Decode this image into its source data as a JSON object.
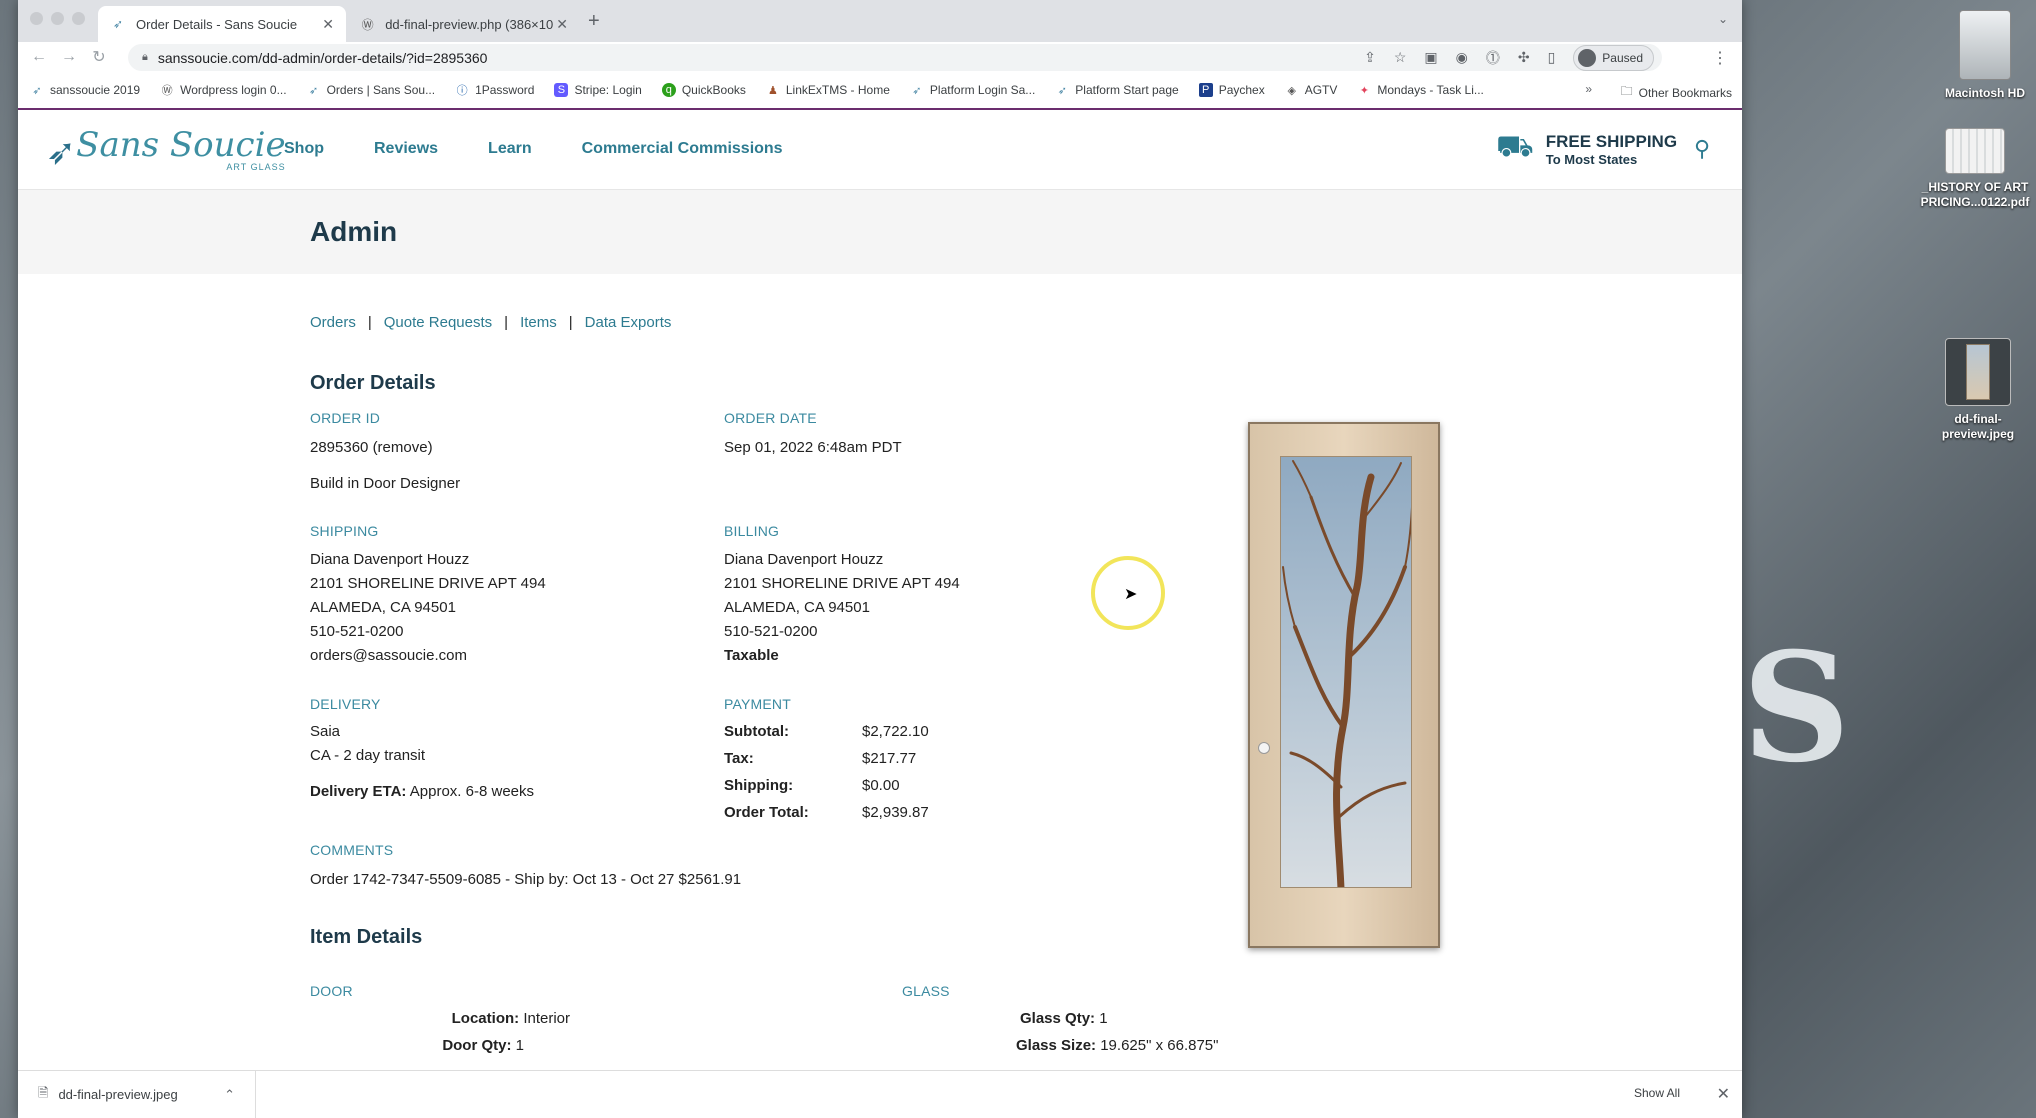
{
  "browser": {
    "tabs": [
      {
        "title": "Order Details - Sans Soucie",
        "active": true
      },
      {
        "title": "dd-final-preview.php (386×10",
        "active": false
      }
    ],
    "url": "sanssoucie.com/dd-admin/order-details/?id=2895360",
    "profile_status": "Paused",
    "bookmarks": [
      "sanssoucie 2019",
      "Wordpress login 0...",
      "Orders | Sans Sou...",
      "1Password",
      "Stripe: Login",
      "QuickBooks",
      "LinkExTMS - Home",
      "Platform Login Sa...",
      "Platform Start page",
      "Paychex",
      "AGTV",
      "Mondays - Task Li..."
    ],
    "bookmarks_more": "»",
    "other_bookmarks": "Other Bookmarks"
  },
  "site": {
    "logo_text": "Sans Soucie",
    "logo_sub": "ART GLASS",
    "nav": [
      "Shop",
      "Reviews",
      "Learn",
      "Commercial Commissions"
    ],
    "shipping_title": "FREE SHIPPING",
    "shipping_sub": "To Most States"
  },
  "admin": {
    "title": "Admin",
    "subnav": [
      "Orders",
      "Quote Requests",
      "Items",
      "Data Exports"
    ],
    "order_details_title": "Order Details",
    "order_id_label": "ORDER ID",
    "order_id_value": "2895360 (remove)",
    "build_note": "Build in Door Designer",
    "order_date_label": "ORDER DATE",
    "order_date_value": "Sep 01, 2022 6:48am PDT",
    "shipping_label": "SHIPPING",
    "shipping": [
      "Diana Davenport Houzz",
      "2101 SHORELINE DRIVE APT 494",
      "ALAMEDA, CA 94501",
      "510-521-0200",
      "orders@sassoucie.com"
    ],
    "billing_label": "BILLING",
    "billing": [
      "Diana Davenport Houzz",
      "2101 SHORELINE DRIVE APT 494",
      "ALAMEDA, CA 94501",
      "510-521-0200"
    ],
    "billing_taxable": "Taxable",
    "delivery_label": "DELIVERY",
    "delivery": [
      "Saia",
      "CA - 2 day transit"
    ],
    "delivery_eta_label": "Delivery ETA:",
    "delivery_eta_value": "Approx. 6-8 weeks",
    "payment_label": "PAYMENT",
    "payment": [
      {
        "k": "Subtotal:",
        "v": "$2,722.10"
      },
      {
        "k": "Tax:",
        "v": "$217.77"
      },
      {
        "k": "Shipping:",
        "v": "$0.00"
      },
      {
        "k": "Order Total:",
        "v": "$2,939.87"
      }
    ],
    "comments_label": "COMMENTS",
    "comments_value": "Order 1742-7347-5509-6085 - Ship by: Oct 13 - Oct 27 $2561.91",
    "item_details_title": "Item Details",
    "door_label": "DOOR",
    "glass_label": "GLASS",
    "door_fields": [
      {
        "k": "Location:",
        "v": "Interior"
      },
      {
        "k": "Door Qty:",
        "v": "1"
      }
    ],
    "glass_fields": [
      {
        "k": "Glass Qty:",
        "v": "1"
      },
      {
        "k": "Glass Size:",
        "v": "19.625\" x 66.875\""
      }
    ]
  },
  "downloads": {
    "file": "dd-final-preview.jpeg",
    "show_all": "Show All"
  },
  "desktop": {
    "icons": [
      "Macintosh HD",
      "_HISTORY OF ART PRICING...0122.pdf",
      "dd-final-preview.jpeg"
    ]
  },
  "colors": {
    "brand_teal": "#2d7b90",
    "label_teal": "#3b8aa0",
    "heading": "#1e3a4a"
  }
}
